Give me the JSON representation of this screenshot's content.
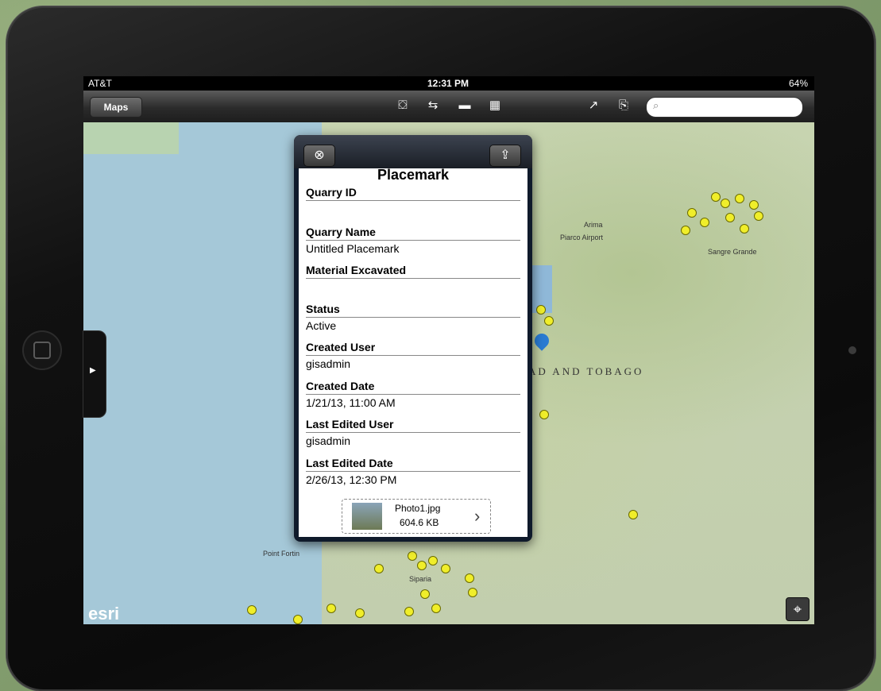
{
  "status_bar": {
    "carrier": "AT&T",
    "time": "12:31 PM",
    "battery": "64%"
  },
  "toolbar": {
    "maps_label": "Maps",
    "search_placeholder": ""
  },
  "map": {
    "labels": [
      "Arima",
      "Sangre Grande",
      "Point Fortin",
      "Siparia",
      "Piarco Airport"
    ],
    "country_label": "AD AND TOBAGO",
    "esri_logo": "esri"
  },
  "popup": {
    "title": "Placemark",
    "fields": [
      {
        "label": "Quarry ID",
        "value": ""
      },
      {
        "label": "Quarry Name",
        "value": "Untitled Placemark"
      },
      {
        "label": "Material Excavated",
        "value": ""
      },
      {
        "label": "Status",
        "value": "Active"
      },
      {
        "label": "Created User",
        "value": "gisadmin"
      },
      {
        "label": "Created Date",
        "value": "1/21/13, 11:00 AM"
      },
      {
        "label": "Last Edited User",
        "value": "gisadmin"
      },
      {
        "label": "Last Edited Date",
        "value": "2/26/13, 12:30 PM"
      }
    ],
    "attachment": {
      "name": "Photo1.jpg",
      "size": "604.6 KB"
    }
  }
}
